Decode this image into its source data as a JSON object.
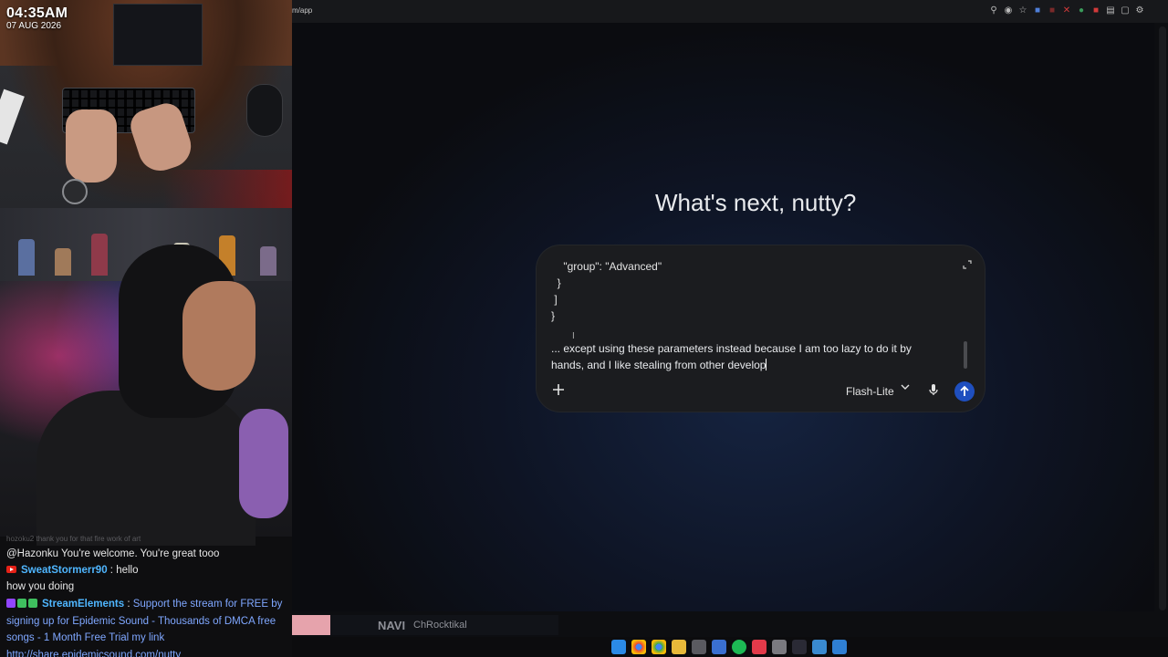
{
  "stream": {
    "clock": {
      "time": "04:35AM",
      "date": "07 AUG 2026"
    },
    "chat": {
      "faded_line": "hozoku2 thank you for that fire work of art",
      "messages": [
        {
          "user": "",
          "text": "@Hazonku You're welcome. You're great tooo"
        },
        {
          "user": "SweatStormerr90",
          "separator": " : ",
          "text": "hello"
        },
        {
          "user": "",
          "text": "how you doing"
        },
        {
          "user": "StreamElements",
          "separator": " : ",
          "text": "Support the stream for FREE by signing up for Epidemic Sound - Thousands of DMCA free songs - 1 Month Free Trial my link http://share.epidemicsound.com/nutty"
        }
      ]
    },
    "banner": {
      "label": "NAVI",
      "name": "ChRocktikal"
    }
  },
  "browser": {
    "url": "m/app",
    "toolbar_icons": [
      "zoom-icon",
      "eye-off-icon",
      "star-icon",
      "extension-icon",
      "extension-icon",
      "extension-icon",
      "extension-icon",
      "extension-icon",
      "extension-icon",
      "extension-icon",
      "extension-icon"
    ]
  },
  "app": {
    "greeting": "What's next, nutty?",
    "composer": {
      "code_lines": [
        "    \"group\": \"Advanced\"",
        "  }",
        " ]",
        "}"
      ],
      "prompt_text": "... except using these parameters instead because I am too lazy to do it by hands, and I like stealing from other develop",
      "model": "Flash-Lite",
      "accent": "#1f4fbf"
    }
  }
}
